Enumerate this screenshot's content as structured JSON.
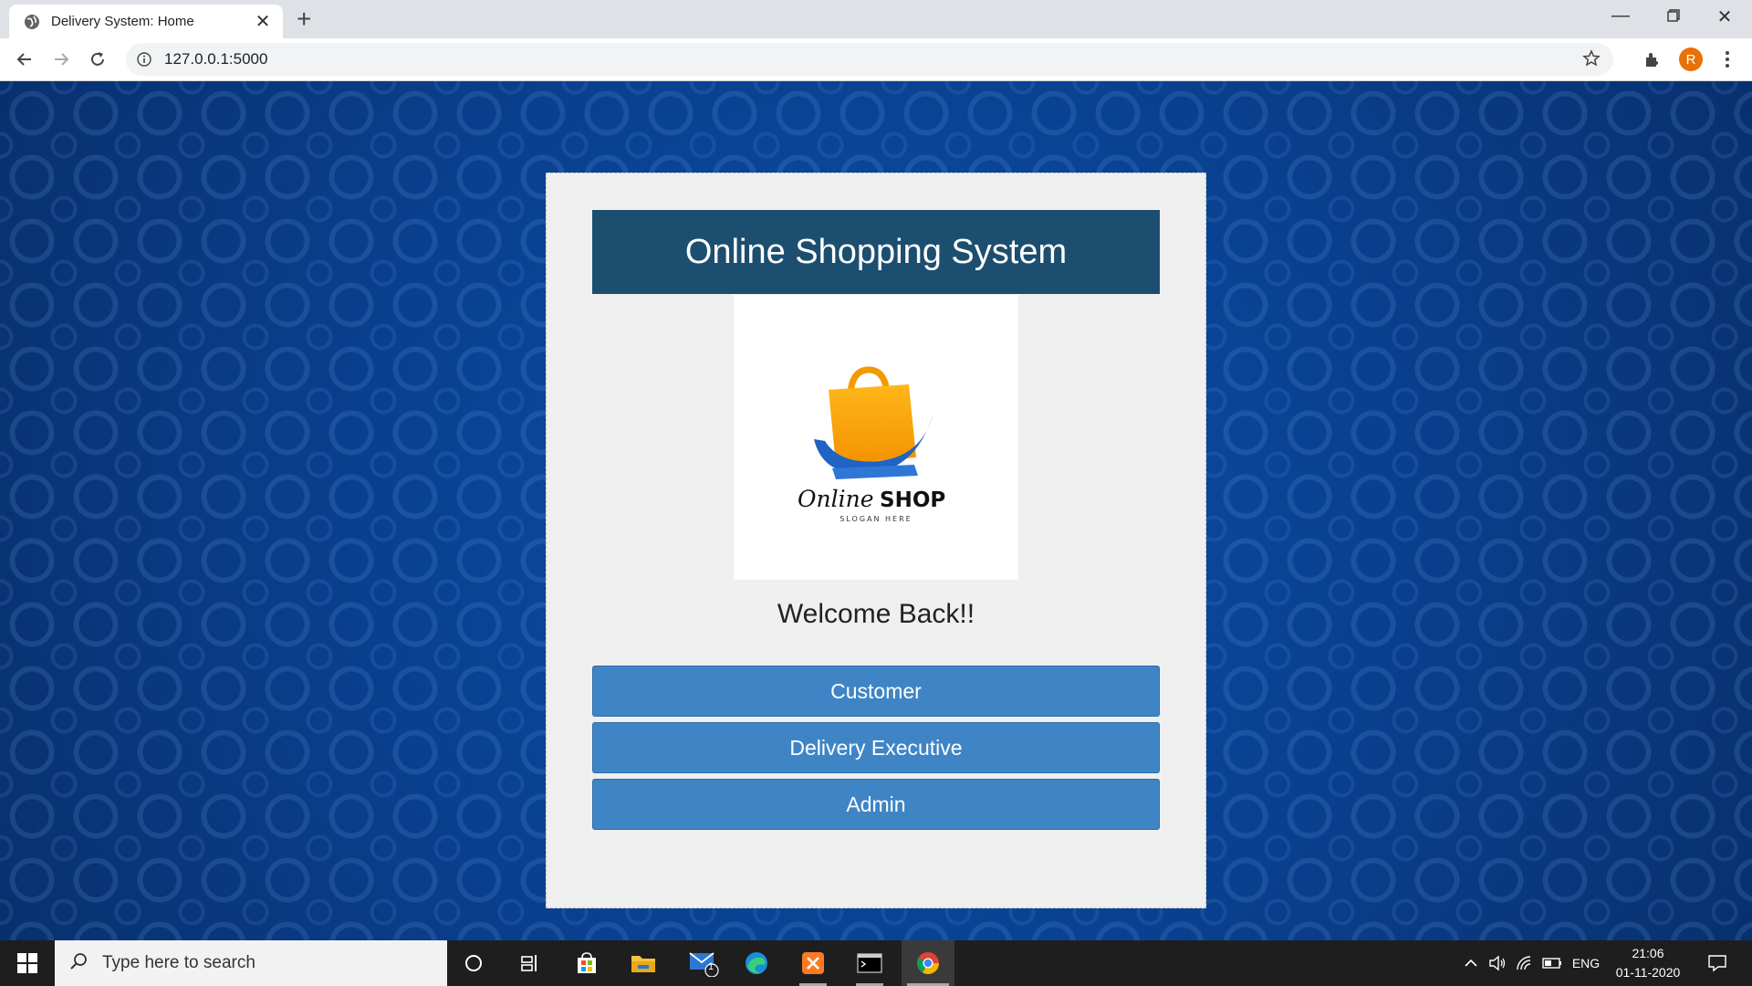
{
  "browser": {
    "tab_title": "Delivery System: Home",
    "url": "127.0.0.1:5000",
    "profile_initial": "R"
  },
  "page": {
    "header_title": "Online Shopping System",
    "logo": {
      "brand_script": "Online",
      "brand_bold": "SHOP",
      "slogan": "SLOGAN HERE"
    },
    "welcome_text": "Welcome Back!!",
    "buttons": {
      "customer": "Customer",
      "delivery_executive": "Delivery Executive",
      "admin": "Admin"
    }
  },
  "taskbar": {
    "search_placeholder": "Type here to search",
    "mail_badge": "1",
    "language": "ENG",
    "time": "21:06",
    "date": "01-11-2020"
  },
  "colors": {
    "header_bg": "#1c4e6f",
    "button_bg": "#3f85c6",
    "page_bg": "#0c50a8"
  }
}
